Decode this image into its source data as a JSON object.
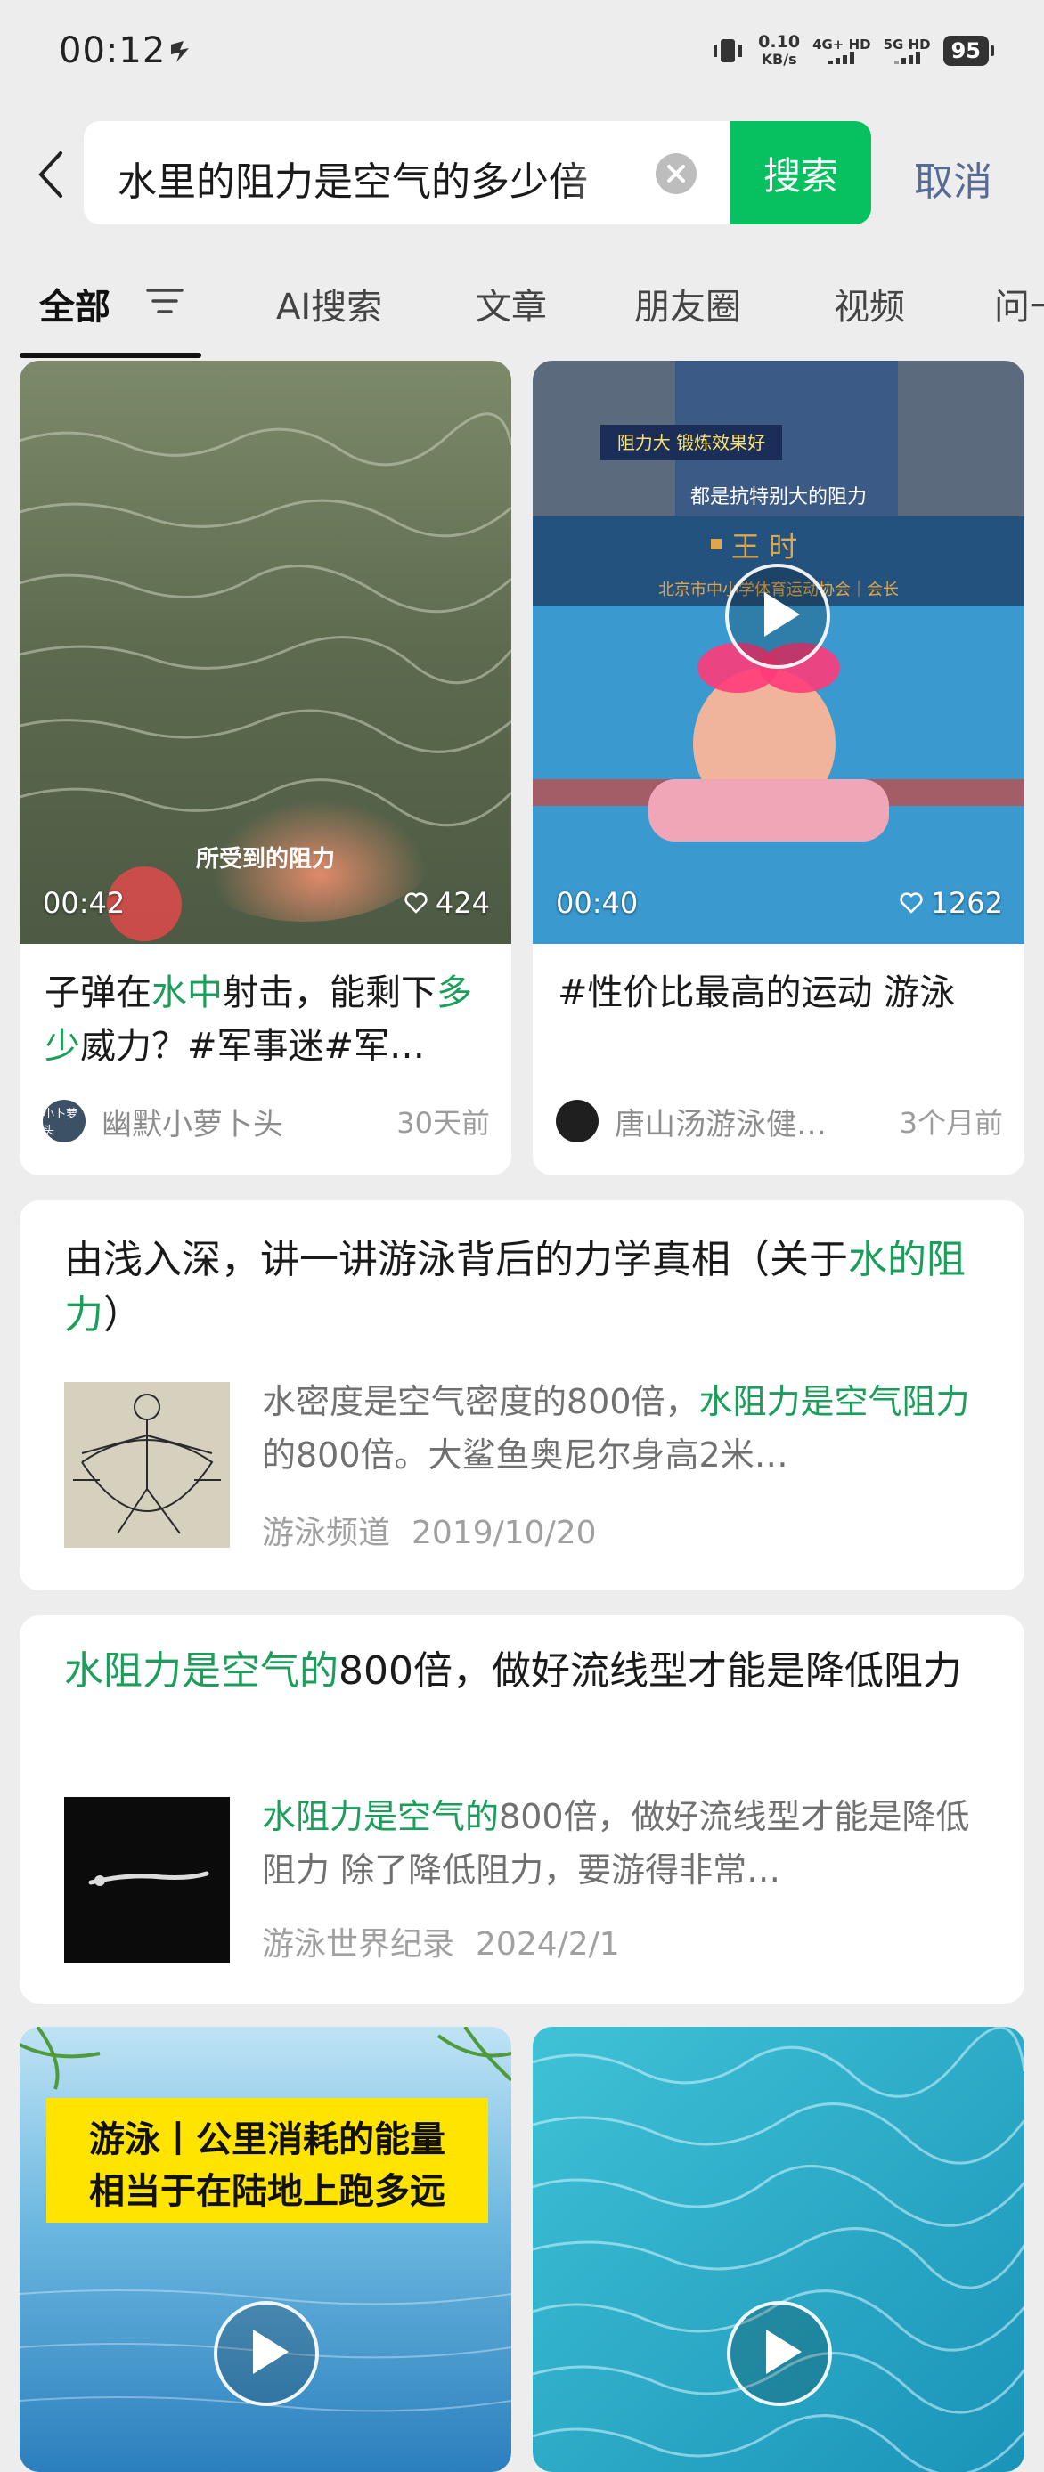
{
  "status_bar": {
    "time": "00:12",
    "net_speed": "0.10",
    "net_unit": "KB/s",
    "sim1": "4G+ HD",
    "sim2": "5G HD",
    "battery": "95"
  },
  "search": {
    "query": "水里的阻力是空气的多少倍",
    "button_label": "搜索",
    "cancel_label": "取消"
  },
  "tabs": [
    {
      "label": "全部",
      "active": true
    },
    {
      "label": "AI搜索"
    },
    {
      "label": "文章"
    },
    {
      "label": "朋友圈"
    },
    {
      "label": "视频"
    },
    {
      "label": "问一"
    }
  ],
  "videos_top": [
    {
      "duration": "00:42",
      "likes": "424",
      "overlay_caption": "所受到的阻力",
      "title_parts": [
        {
          "t": "子弹在",
          "hl": false
        },
        {
          "t": "水中",
          "hl": true
        },
        {
          "t": "射击，能剩下",
          "hl": false
        },
        {
          "t": "多少",
          "hl": true
        },
        {
          "t": "威力？#军事迷#军…",
          "hl": false
        }
      ],
      "avatar_text": "小卜萝头",
      "author": "幽默小萝卜头",
      "ago": "30天前"
    },
    {
      "duration": "00:40",
      "likes": "1262",
      "overlay_tag": "阻力大 锻炼效果好",
      "overlay_caption": "都是抗特别大的阻力",
      "overlay_name": "王 时",
      "overlay_org": "北京市中小学体育运动协会｜会长",
      "title_parts": [
        {
          "t": "#性价比最高的运动 游泳",
          "hl": false
        }
      ],
      "avatar_text": "",
      "author": "唐山汤游泳健…",
      "ago": "3个月前"
    }
  ],
  "articles": [
    {
      "title_parts": [
        {
          "t": "由浅入深，讲一讲游泳背后的力学真相（关于",
          "hl": false
        },
        {
          "t": "水的阻力",
          "hl": true
        },
        {
          "t": "）",
          "hl": false
        }
      ],
      "snippet_parts": [
        {
          "t": "水密度是空气密度的800倍，",
          "hl": false
        },
        {
          "t": "水阻力是空气阻力",
          "hl": true
        },
        {
          "t": "的800倍。大鲨鱼奥尼尔身高2米…",
          "hl": false
        }
      ],
      "source": "游泳频道",
      "date": "2019/10/20"
    },
    {
      "title_parts": [
        {
          "t": "水阻力是空气的",
          "hl": true
        },
        {
          "t": "800倍，做好流线型才能是降低阻力",
          "hl": false
        }
      ],
      "snippet_parts": [
        {
          "t": "水阻力是空气的",
          "hl": true
        },
        {
          "t": "800倍，做好流线型才能是降低阻力 除了降低阻力，要游得非常…",
          "hl": false
        }
      ],
      "source": "游泳世界纪录",
      "date": "2024/2/1"
    }
  ],
  "videos_bottom": [
    {
      "banner_line1": "游泳丨公里消耗的能量",
      "banner_line2": "相当于在陆地上跑多远"
    },
    {}
  ],
  "colors": {
    "accent_green": "#07c160",
    "highlight": "#1a9e5a",
    "link_blue": "#576b95"
  }
}
